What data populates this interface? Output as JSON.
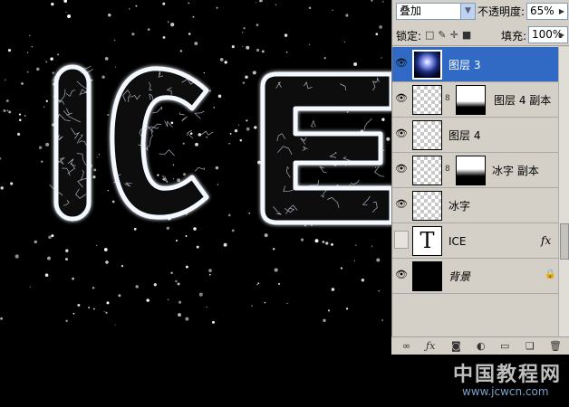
{
  "canvas": {
    "artwork_text": "ICE"
  },
  "layers_panel": {
    "blend_mode": "叠加",
    "opacity_label": "不透明度:",
    "opacity_value": "65%",
    "lock_label": "锁定:",
    "fill_label": "填充:",
    "fill_value": "100%",
    "layers": [
      {
        "name": "图层 3",
        "visible": true,
        "selected": true
      },
      {
        "name": "图层 4 副本",
        "visible": true,
        "selected": false
      },
      {
        "name": "图层 4",
        "visible": true,
        "selected": false
      },
      {
        "name": "冰字 副本",
        "visible": true,
        "selected": false
      },
      {
        "name": "冰字",
        "visible": true,
        "selected": false
      },
      {
        "name": "ICE",
        "visible": false,
        "selected": false,
        "text_thumb": "T",
        "fx": "fx"
      },
      {
        "name": "背景",
        "visible": true,
        "selected": false
      }
    ]
  },
  "watermark": {
    "title": "中国教程网",
    "url": "www.jcwcn.com"
  },
  "colors": {
    "panel_bg": "#d4d0c8",
    "selection": "#316ac5",
    "canvas_bg": "#000000"
  }
}
